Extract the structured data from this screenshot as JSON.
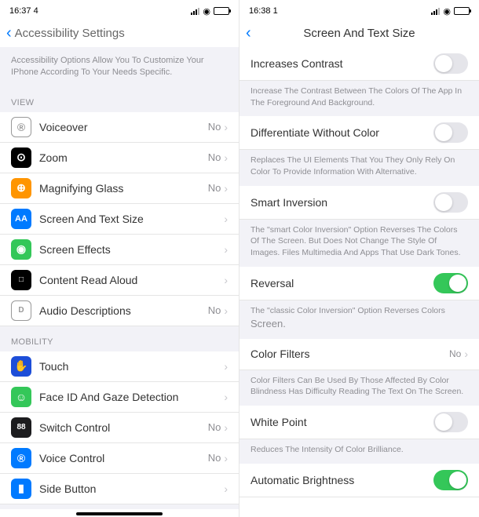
{
  "left": {
    "status": {
      "time": "16:37 4"
    },
    "nav": {
      "title": "Accessibility Settings"
    },
    "intro": "Accessibility Options Allow You To Customize Your IPhone According To Your Needs Specific.",
    "section_view": "VIEW",
    "section_mobility": "MOBILITY",
    "rows": {
      "voiceover": {
        "label": "Voiceover",
        "value": "No"
      },
      "zoom": {
        "label": "Zoom",
        "value": "No"
      },
      "magnifying": {
        "label": "Magnifying Glass",
        "value": "No"
      },
      "screentext": {
        "label": "Screen And Text Size",
        "value": ""
      },
      "effects": {
        "label": "Screen Effects",
        "value": ""
      },
      "readaloud": {
        "label": "Content Read Aloud",
        "value": ""
      },
      "audiodesc": {
        "label": "Audio Descriptions",
        "value": "No"
      },
      "touch": {
        "label": "Touch",
        "value": ""
      },
      "faceid": {
        "label": "Face ID And Gaze Detection",
        "value": ""
      },
      "switch": {
        "label": "Switch Control",
        "value": "No"
      },
      "voicectrl": {
        "label": "Voice Control",
        "value": "No"
      },
      "sidebtn": {
        "label": "Side Button",
        "value": ""
      }
    }
  },
  "right": {
    "status": {
      "time": "16:38 1"
    },
    "nav": {
      "title": "Screen And Text Size"
    },
    "contrast": {
      "label": "Increases Contrast",
      "desc": "Increase The Contrast Between The Colors Of The App In The Foreground And Background."
    },
    "diffcolor": {
      "label": "Differentiate Without Color",
      "desc": "Replaces The UI Elements That You They Only Rely On Color To Provide Information With Alternative."
    },
    "smartinv": {
      "label": "Smart Inversion",
      "desc": "The \"smart Color Inversion\" Option Reverses The Colors Of The Screen. But Does Not Change The Style Of Images. Files Multimedia And Apps That Use Dark Tones."
    },
    "reversal": {
      "label": "Reversal",
      "desc": "The \"classic Color Inversion\" Option Reverses Colors",
      "desc2": "Screen."
    },
    "colorfilters": {
      "label": "Color Filters",
      "value": "No",
      "desc": "Color Filters Can Be Used By Those Affected By Color Blindness Has Difficulty Reading The Text On The Screen."
    },
    "whitepoint": {
      "label": "White Point",
      "desc": "Reduces The Intensity Of Color Brilliance."
    },
    "autobright": {
      "label": "Automatic Brightness"
    }
  }
}
